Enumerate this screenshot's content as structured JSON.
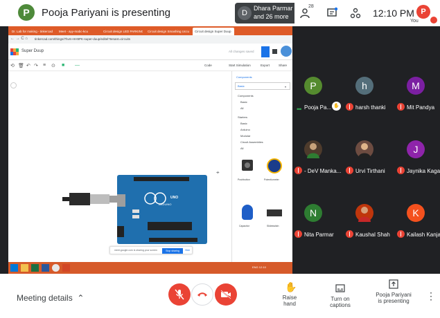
{
  "presenter": {
    "avatar_letter": "P",
    "text": "Pooja Pariyani is presenting"
  },
  "notification": {
    "avatar_letter": "D",
    "line1": "Dhara Parmar",
    "line2": "and 26 more"
  },
  "topbar": {
    "people_count": "28",
    "time": "12:10 PM",
    "you_letter": "P",
    "you_label": "You"
  },
  "shared_screen": {
    "tabs": [
      "Dr. Lab for making - tinkercad",
      "Meet - ayy-mabc-kcu",
      "Circuit design LED PARKING",
      "Circuit design Smashing Uccu",
      "Circuit design Super Duup"
    ],
    "url": "tinkercad.com/things/7hvm-HH9PK-super-duup/editel?tenant=circuits",
    "project_name": "Super Duup",
    "saved_status": "All changes saved",
    "toolbar": {
      "code": "Code",
      "start_sim": "Start Simulation",
      "export": "Export",
      "share": "Share"
    },
    "panel": {
      "header": "Components",
      "selected": "Basic",
      "items": [
        "Components",
        "Basic",
        "All",
        "Starters",
        "Basic",
        "Arduino",
        "Modular",
        "Circuit Assemblies",
        "All"
      ],
      "components": [
        "Pushbutton",
        "Potentiometer",
        "Capacitor",
        "Slideswitch"
      ]
    },
    "board": {
      "brand": "ARDUINO",
      "model": "UNO"
    },
    "sharebar": {
      "text": "meet.google.com is sharing your screen",
      "stop": "Stop sharing",
      "hide": "Hide"
    },
    "tray_text": "ENG 12:10"
  },
  "participants": [
    {
      "name": "Pooja Pa...",
      "letter": "P",
      "color": "#558b2f",
      "muted": false,
      "hand": true
    },
    {
      "name": "harsh thanki",
      "letter": "h",
      "color": "#546e7a",
      "muted": true
    },
    {
      "name": "Mit Pandya",
      "letter": "M",
      "color": "#7b1fa2",
      "muted": true
    },
    {
      "name": "- DeV Manka...",
      "letter": "",
      "color": "#5d4037",
      "muted": true,
      "photo": true
    },
    {
      "name": "Urvi Tirthani",
      "letter": "",
      "color": "#6d4c41",
      "muted": true,
      "photo": true
    },
    {
      "name": "Jaynika Kaga...",
      "letter": "J",
      "color": "#8e24aa",
      "muted": true
    },
    {
      "name": "Nita Parmar",
      "letter": "N",
      "color": "#2e7d32",
      "muted": true
    },
    {
      "name": "Kaushal Shah",
      "letter": "",
      "color": "#bf360c",
      "muted": true,
      "photo": true
    },
    {
      "name": "Kailash Kanja...",
      "letter": "K",
      "color": "#f4511e",
      "muted": true
    }
  ],
  "bottom": {
    "meeting_details": "Meeting details",
    "raise_hand": "Raise hand",
    "captions": "Turn on captions",
    "presenting_line1": "Pooja Pariyani",
    "presenting_line2": "is presenting"
  },
  "colors": {
    "accent_red": "#ea4335",
    "tab_orange": "#de5b28",
    "arduino_blue": "#1f6fae"
  }
}
